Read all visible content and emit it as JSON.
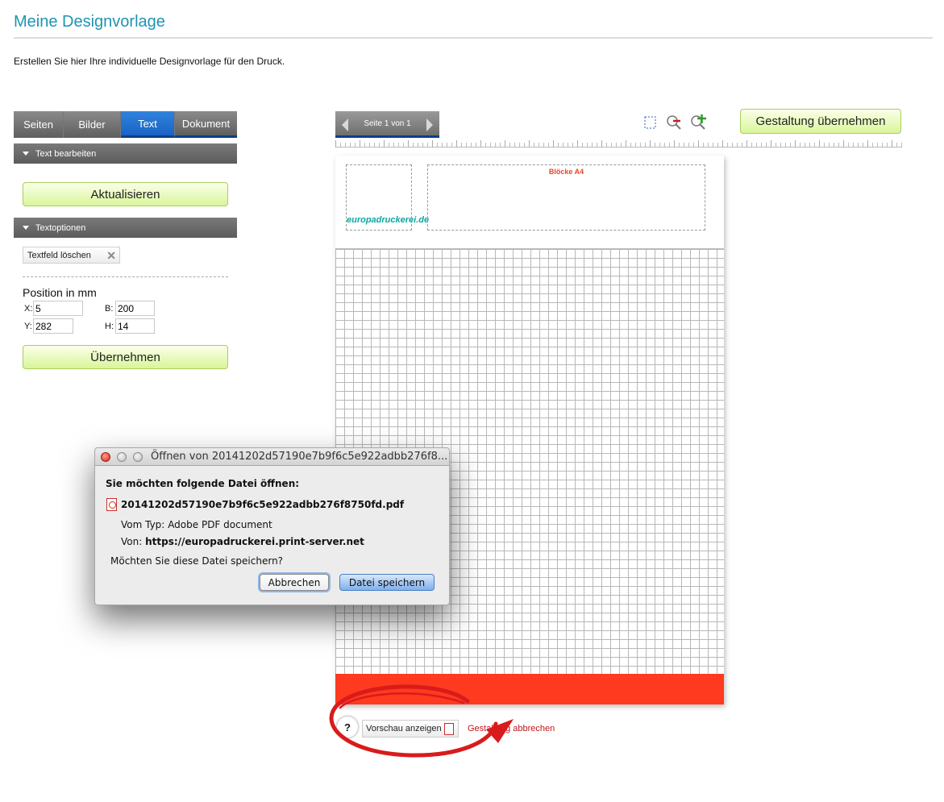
{
  "header": {
    "title": "Meine Designvorlage",
    "subtitle": "Erstellen Sie hier Ihre individuelle Designvorlage für den Druck."
  },
  "tabs": [
    {
      "label": "Seiten",
      "active": false
    },
    {
      "label": "Bilder",
      "active": false
    },
    {
      "label": "Text",
      "active": true
    },
    {
      "label": "Dokument",
      "active": false
    }
  ],
  "sidebar": {
    "section_text_edit": "Text bearbeiten",
    "update_button": "Aktualisieren",
    "section_text_options": "Textoptionen",
    "delete_textfield": "Textfeld löschen",
    "position_label": "Position in mm",
    "fields": {
      "x_label": "X:",
      "x_value": "5",
      "b_label": "B:",
      "b_value": "200",
      "y_label": "Y:",
      "y_value": "282",
      "h_label": "H:",
      "h_value": "14"
    },
    "apply_button": "Übernehmen"
  },
  "editor": {
    "page_nav_label": "Seite 1 von 1",
    "tools": [
      "select-icon",
      "zoom-out-icon",
      "zoom-in-icon"
    ],
    "accept_design_button": "Gestaltung übernehmen",
    "canvas_title_text": "Blöcke A4",
    "logo_text": "europadruckerei.de",
    "footer_color": "#ff3a1f"
  },
  "bottom": {
    "help_label": "?",
    "preview_button": "Vorschau anzeigen",
    "cancel_design_link": "Gestaltung abbrechen"
  },
  "dialog": {
    "title": "Öffnen von 20141202d57190e7b9f6c5e922adbb276f8...",
    "heading": "Sie möchten folgende Datei öffnen:",
    "filename": "20141202d57190e7b9f6c5e922adbb276f8750fd.pdf",
    "type_label": "Vom Typ:",
    "type_value": "Adobe PDF document",
    "from_label": "Von:",
    "from_value": "https://europadruckerei.print-server.net",
    "question": "Möchten Sie diese Datei speichern?",
    "cancel_button": "Abbrechen",
    "save_button": "Datei speichern"
  },
  "colors": {
    "title_blue": "#1d94b3",
    "tab_active": "#1a63c4",
    "green_button": "#d9f59a",
    "accent_red": "#ff3a1f",
    "link_red": "#c2141c"
  }
}
